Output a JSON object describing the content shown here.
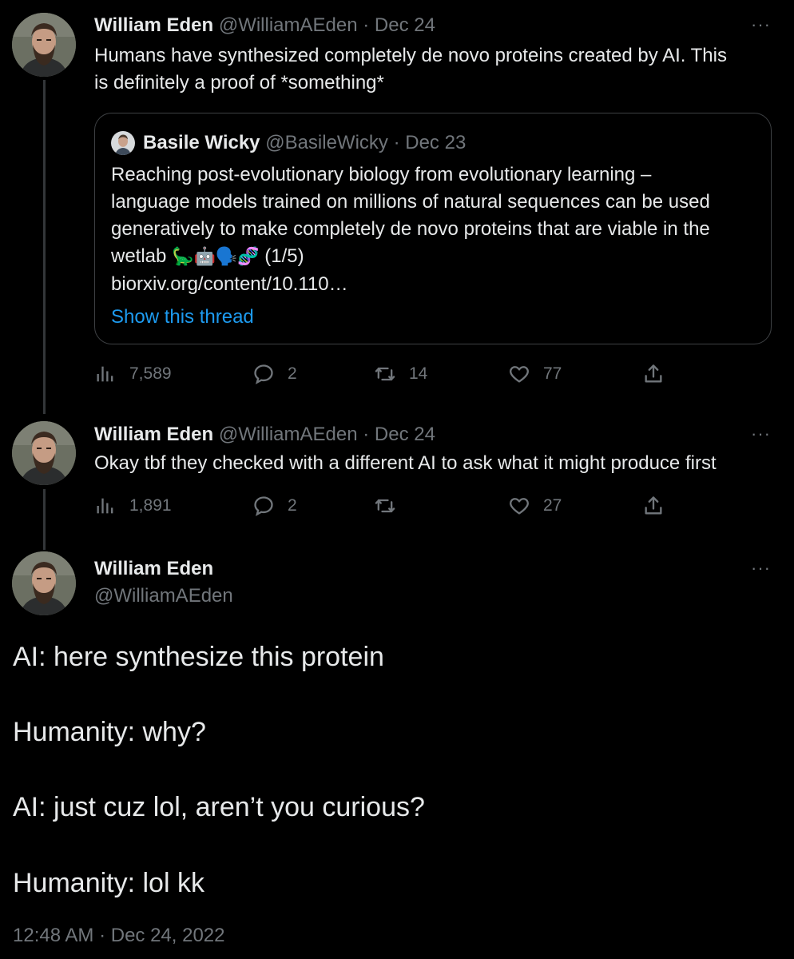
{
  "tweet1": {
    "name": "William Eden",
    "handle": "@WilliamAEden",
    "date": "· Dec 24",
    "text_line1": "Humans have synthesized completely de novo proteins created by AI. This",
    "text_line2": "is definitely a proof of *something*",
    "quote": {
      "name": "Basile Wicky",
      "handle": "@BasileWicky",
      "date": "· Dec 23",
      "line1": "Reaching post-evolutionary biology from evolutionary learning –",
      "line2": "language models trained on millions of natural sequences can be used",
      "line3": "generatively to make completely de novo proteins that are viable in the",
      "line4_word": "wetlab",
      "line4_emoji": "🦕🤖🗣️🧬",
      "line4_suffix": "(1/5)",
      "link": "biorxiv.org/content/10.110…",
      "show_thread": "Show this thread"
    },
    "views": "7,589",
    "replies": "2",
    "retweets": "14",
    "likes": "77"
  },
  "tweet2": {
    "name": "William Eden",
    "handle": "@WilliamAEden",
    "date": "· Dec 24",
    "text": "Okay tbf they checked with a different AI to ask what it might produce first",
    "views": "1,891",
    "replies": "2",
    "retweets": "",
    "likes": "27"
  },
  "tweet3": {
    "name": "William Eden",
    "handle": "@WilliamAEden",
    "lines": [
      "AI: here synthesize this protein",
      "Humanity: why?",
      "AI: just cuz lol, aren’t you curious?",
      "Humanity: lol kk"
    ],
    "timestamp": "12:48 AM · Dec 24, 2022"
  },
  "more_glyph": "···",
  "colors": {
    "background": "#000000",
    "text": "#e7e9ea",
    "muted": "#71767b",
    "link": "#1d9bf0",
    "border": "#3e4144"
  },
  "icons": [
    "views-icon",
    "reply-icon",
    "retweet-icon",
    "like-icon",
    "share-icon",
    "more-icon",
    "avatar"
  ]
}
